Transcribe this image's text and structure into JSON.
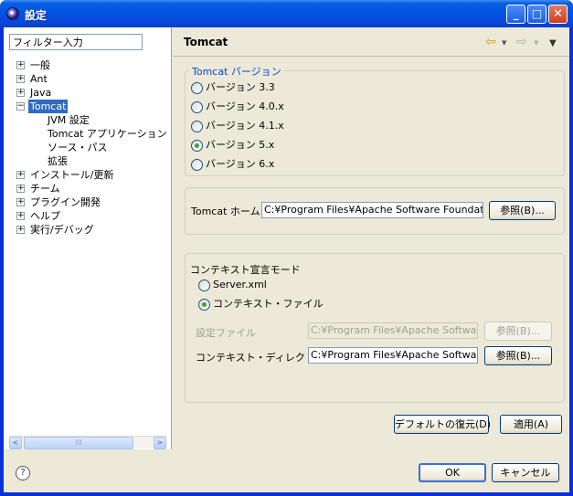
{
  "window": {
    "title": "設定"
  },
  "titlebar_buttons": {
    "minimize": "_",
    "maximize": "□",
    "close": "✕"
  },
  "filter": {
    "value": "フィルター入力"
  },
  "tree": [
    {
      "label": "一般",
      "expander": "+"
    },
    {
      "label": "Ant",
      "expander": "+"
    },
    {
      "label": "Java",
      "expander": "+"
    },
    {
      "label": "Tomcat",
      "expander": "−",
      "selected": true
    },
    {
      "label": "JVM 設定"
    },
    {
      "label": "Tomcat アプリケーション・マ"
    },
    {
      "label": "ソース・パス"
    },
    {
      "label": "拡張"
    },
    {
      "label": "インストール/更新",
      "expander": "+"
    },
    {
      "label": "チーム",
      "expander": "+"
    },
    {
      "label": "プラグイン開発",
      "expander": "+"
    },
    {
      "label": "ヘルプ",
      "expander": "+"
    },
    {
      "label": "実行/デバッグ",
      "expander": "+"
    }
  ],
  "scrollbar": {
    "left": "<",
    "right": ">",
    "grip": "III"
  },
  "page": {
    "title": "Tomcat"
  },
  "nav": {
    "back": "⇦",
    "forward": "⇨",
    "dropdown": "▼",
    "menu": "▼"
  },
  "version_group": {
    "title": "Tomcat バージョン",
    "options": [
      {
        "label": "バージョン 3.3",
        "checked": false
      },
      {
        "label": "バージョン 4.0.x",
        "checked": false
      },
      {
        "label": "バージョン 4.1.x",
        "checked": false
      },
      {
        "label": "バージョン 5.x",
        "checked": true
      },
      {
        "label": "バージョン 6.x",
        "checked": false
      }
    ]
  },
  "home": {
    "label": "Tomcat ホーム",
    "value": "C:¥Program Files¥Apache Software Foundation",
    "browse": "参照(B)..."
  },
  "context_mode": {
    "label": "コンテキスト宣言モード",
    "options": [
      {
        "label": "Server.xml",
        "checked": false
      },
      {
        "label": "コンテキスト・ファイル",
        "checked": true
      }
    ],
    "config_file_label": "設定ファイル",
    "config_file_value": "C:¥Program Files¥Apache Software",
    "config_browse": "参照(B)...",
    "context_dir_label": "コンテキスト・ディレクトリー",
    "context_dir_value": "C:¥Program Files¥Apache Software",
    "context_browse": "参照(B)..."
  },
  "restore_defaults": "デフォルトの復元(D)",
  "apply": "適用(A)",
  "ok": "OK",
  "cancel": "キャンセル",
  "help": "?"
}
